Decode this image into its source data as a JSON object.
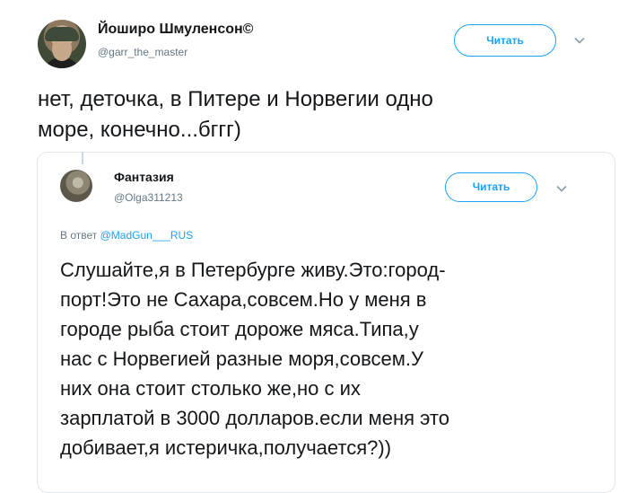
{
  "outer_tweet": {
    "display_name": "Йоширо Шмуленсон©",
    "handle": "@garr_the_master",
    "follow_label": "Читать",
    "text_lines": [
      "нет, деточка, в Питере и Норвегии одно",
      "море, конечно...бггг)"
    ]
  },
  "quoted_tweet": {
    "display_name": "Фантазия",
    "handle": "@Olga311213",
    "follow_label": "Читать",
    "reply_prefix": "В ответ",
    "reply_handle": "@MadGun___RUS",
    "text_lines": [
      "Слушайте,я в Петербурге живу.Это:город-",
      "порт!Это не Сахара,совсем.Но у меня в",
      "городе рыба стоит дороже мяса.Типа,у",
      "нас с Норвегией разные моря,совсем.У",
      "них она стоит столько же,но с их",
      "зарплатой в 3000 долларов.если меня это",
      "добивает,я истеричка,получается?))"
    ]
  },
  "icons": {
    "menu": "chevron-down-icon"
  },
  "colors": {
    "accent": "#1da1f2",
    "secondary_text": "#657786",
    "border": "#e1e8ed"
  }
}
